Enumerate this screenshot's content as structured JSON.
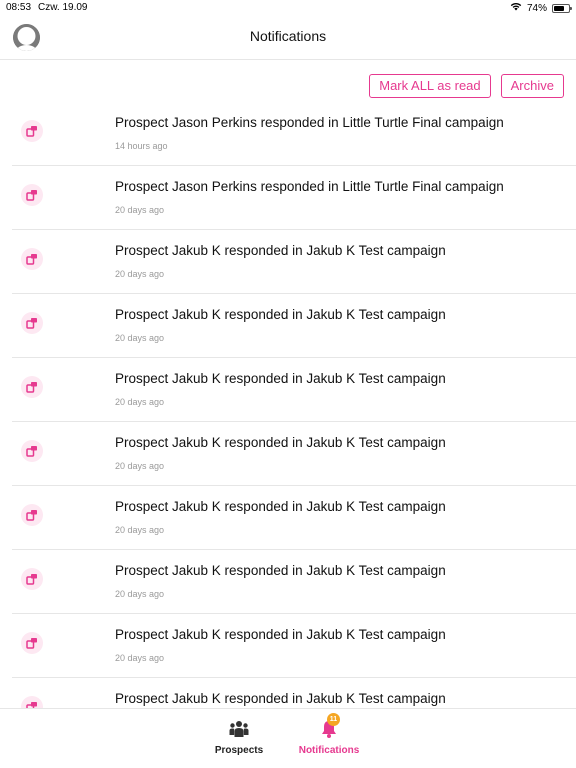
{
  "status_bar": {
    "time": "08:53",
    "date": "Czw. 19.09",
    "battery": "74%",
    "battery_level": 0.74
  },
  "header": {
    "title": "Notifications"
  },
  "actions": {
    "mark_all_read": "Mark ALL as read",
    "archive": "Archive"
  },
  "notifications": [
    {
      "text": "Prospect Jason Perkins responded in Little Turtle Final campaign",
      "ago": "14 hours ago"
    },
    {
      "text": "Prospect Jason Perkins responded in Little Turtle Final campaign",
      "ago": "20 days ago"
    },
    {
      "text": "Prospect Jakub K responded in Jakub K Test campaign",
      "ago": "20 days ago"
    },
    {
      "text": "Prospect Jakub K responded in Jakub K Test campaign",
      "ago": "20 days ago"
    },
    {
      "text": "Prospect Jakub K responded in Jakub K Test campaign",
      "ago": "20 days ago"
    },
    {
      "text": "Prospect Jakub K responded in Jakub K Test campaign",
      "ago": "20 days ago"
    },
    {
      "text": "Prospect Jakub K responded in Jakub K Test campaign",
      "ago": "20 days ago"
    },
    {
      "text": "Prospect Jakub K responded in Jakub K Test campaign",
      "ago": "20 days ago"
    },
    {
      "text": "Prospect Jakub K responded in Jakub K Test campaign",
      "ago": "20 days ago"
    },
    {
      "text": "Prospect Jakub K responded in Jakub K Test campaign",
      "ago": ""
    }
  ],
  "tabbar": {
    "prospects_label": "Prospects",
    "notifications_label": "Notifications",
    "notifications_badge": "11"
  },
  "colors": {
    "accent": "#e6398f",
    "badge": "#f5a623",
    "icon_bg": "#fde8f2"
  },
  "icons": {
    "notification_item": "reply-message-icon",
    "prospects_tab": "group-icon",
    "notifications_tab": "bell-icon",
    "avatar": "user-avatar-icon"
  }
}
